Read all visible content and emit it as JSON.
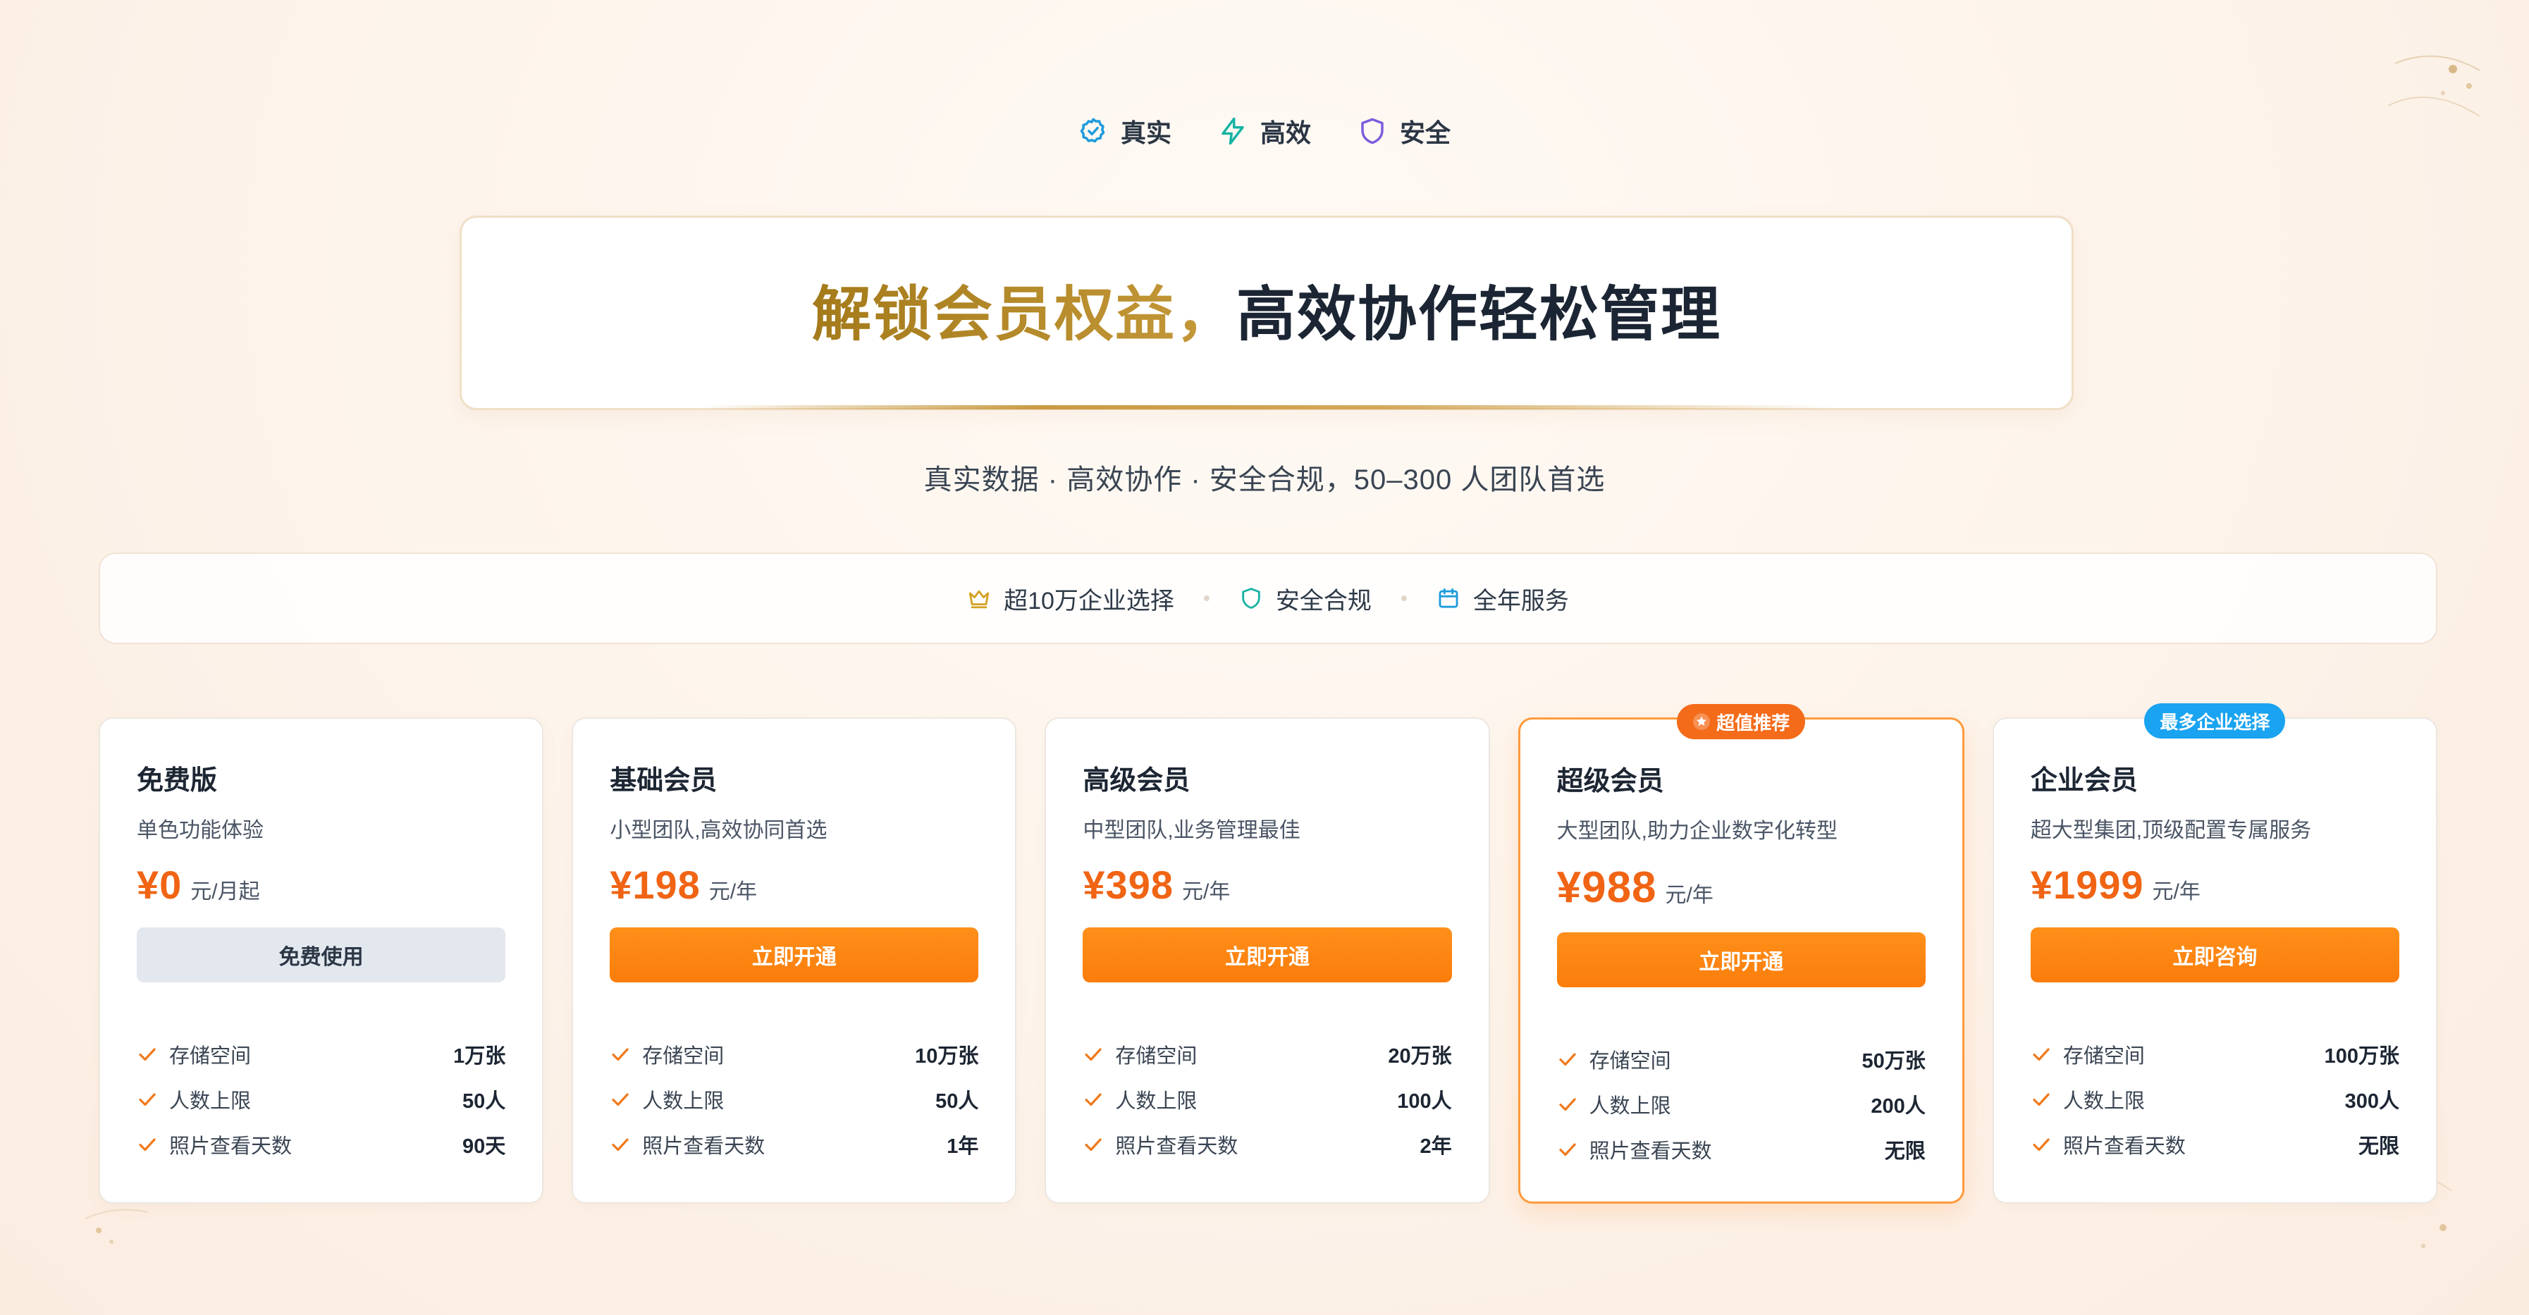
{
  "badges": [
    {
      "label": "真实",
      "icon": "check-circle-icon",
      "color": "#1e9bdc"
    },
    {
      "label": "高效",
      "icon": "lightning-icon",
      "color": "#17b3a4"
    },
    {
      "label": "安全",
      "icon": "shield-icon",
      "color": "#7c5cdc"
    }
  ],
  "hero": {
    "title_highlight": "解锁会员权益，",
    "title_rest": "高效协作轻松管理"
  },
  "subtitle": "真实数据 · 高效协作 · 安全合规，50–300 人团队首选",
  "stats": [
    {
      "label": "超10万企业选择",
      "icon": "crown-icon",
      "color": "#d4a020"
    },
    {
      "label": "安全合规",
      "icon": "shield-icon",
      "color": "#17b3a4"
    },
    {
      "label": "全年服务",
      "icon": "calendar-icon",
      "color": "#1e9bdc"
    }
  ],
  "plans": [
    {
      "name": "免费版",
      "desc": "单色功能体验",
      "price": "¥0",
      "unit": "元/月起",
      "button": "免费使用",
      "tag": "",
      "features": [
        {
          "label": "存储空间",
          "value": "1万张"
        },
        {
          "label": "人数上限",
          "value": "50人"
        },
        {
          "label": "照片查看天数",
          "value": "90天"
        }
      ]
    },
    {
      "name": "基础会员",
      "desc": "小型团队,高效协同首选",
      "price": "¥198",
      "unit": "元/年",
      "button": "立即开通",
      "tag": "",
      "features": [
        {
          "label": "存储空间",
          "value": "10万张"
        },
        {
          "label": "人数上限",
          "value": "50人"
        },
        {
          "label": "照片查看天数",
          "value": "1年"
        }
      ]
    },
    {
      "name": "高级会员",
      "desc": "中型团队,业务管理最佳",
      "price": "¥398",
      "unit": "元/年",
      "button": "立即开通",
      "tag": "",
      "features": [
        {
          "label": "存储空间",
          "value": "20万张"
        },
        {
          "label": "人数上限",
          "value": "100人"
        },
        {
          "label": "照片查看天数",
          "value": "2年"
        }
      ]
    },
    {
      "name": "超级会员",
      "desc": "大型团队,助力企业数字化转型",
      "price": "¥988",
      "unit": "元/年",
      "button": "立即开通",
      "tag": "超值推荐",
      "features": [
        {
          "label": "存储空间",
          "value": "50万张"
        },
        {
          "label": "人数上限",
          "value": "200人"
        },
        {
          "label": "照片查看天数",
          "value": "无限"
        }
      ]
    },
    {
      "name": "企业会员",
      "desc": "超大型集团,顶级配置专属服务",
      "price": "¥1999",
      "unit": "元/年",
      "button": "立即咨询",
      "tag": "最多企业选择",
      "features": [
        {
          "label": "存储空间",
          "value": "100万张"
        },
        {
          "label": "人数上限",
          "value": "300人"
        },
        {
          "label": "照片查看天数",
          "value": "无限"
        }
      ]
    }
  ],
  "colors": {
    "accent": "#fb8410",
    "price": "#f06414",
    "check": "#f07a1c",
    "featured_border": "#ff9a3c",
    "tag_orange": "#f46b1a",
    "tag_blue": "#1aa3f0"
  }
}
